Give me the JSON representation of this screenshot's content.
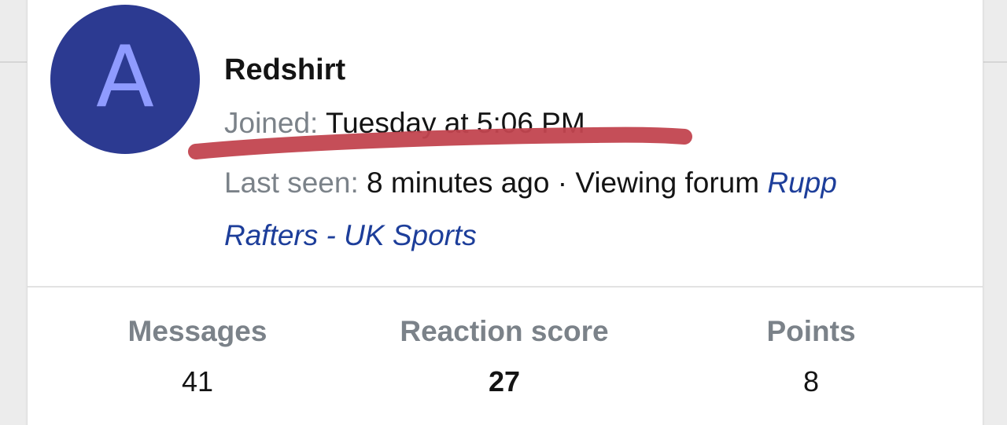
{
  "profile": {
    "avatar_letter": "A",
    "username": "Redshirt",
    "joined_label": "Joined:",
    "joined_value": "Tuesday at 5:06 PM",
    "last_seen_label": "Last seen:",
    "last_seen_value": "8 minutes ago · Viewing forum",
    "forum_link_part1": "Rupp",
    "forum_link_part2": "Rafters - UK Sports"
  },
  "stats": [
    {
      "label": "Messages",
      "value": "41"
    },
    {
      "label": "Reaction score",
      "value": "27"
    },
    {
      "label": "Points",
      "value": "8"
    }
  ],
  "colors": {
    "avatar_bg": "#2c3a91",
    "avatar_letter": "#8f9bff",
    "link": "#1d3e9a",
    "label_gray": "#7b8289",
    "annotation_red": "#c2454f"
  }
}
